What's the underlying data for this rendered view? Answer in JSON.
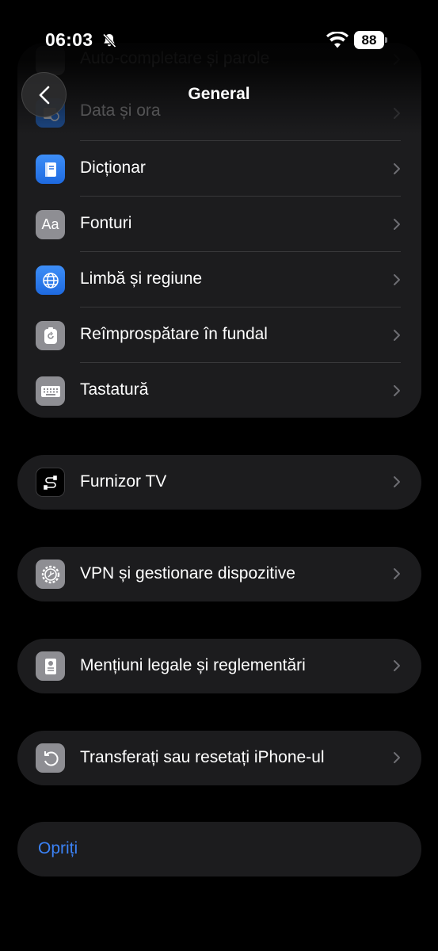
{
  "status_bar": {
    "time": "06:03",
    "battery": "88"
  },
  "nav": {
    "title": "General",
    "back_icon": "chevron-left-icon"
  },
  "groups": [
    {
      "items": [
        {
          "label": "Auto-completare și parole",
          "icon": "key-icon",
          "color": "#8e8e93"
        },
        {
          "label": "Data și ora",
          "icon": "calendar-clock-icon",
          "color": "#1e72e8"
        },
        {
          "label": "Dicționar",
          "icon": "book-icon",
          "color": "#1e72e8"
        },
        {
          "label": "Fonturi",
          "icon": "font-aa-icon",
          "color": "#8e8e93"
        },
        {
          "label": "Limbă și regiune",
          "icon": "globe-icon",
          "color": "#1e72e8"
        },
        {
          "label": "Reîmprospătare în fundal",
          "icon": "refresh-icon",
          "color": "#8e8e93"
        },
        {
          "label": "Tastatură",
          "icon": "keyboard-icon",
          "color": "#8e8e93"
        }
      ]
    },
    {
      "items": [
        {
          "label": "Furnizor TV",
          "icon": "tv-provider-icon",
          "color": "#000000"
        }
      ]
    },
    {
      "items": [
        {
          "label": "VPN și gestionare dispozitive",
          "icon": "gear-icon",
          "color": "#8e8e93"
        }
      ]
    },
    {
      "items": [
        {
          "label": "Mențiuni legale și reglementări",
          "icon": "legal-doc-icon",
          "color": "#8e8e93"
        }
      ]
    },
    {
      "items": [
        {
          "label": "Transferați sau resetați iPhone-ul",
          "icon": "reset-arrow-icon",
          "color": "#8e8e93"
        }
      ]
    },
    {
      "items": [
        {
          "label": "Opriți",
          "style": "link",
          "color": "#3b82f6"
        }
      ]
    }
  ]
}
